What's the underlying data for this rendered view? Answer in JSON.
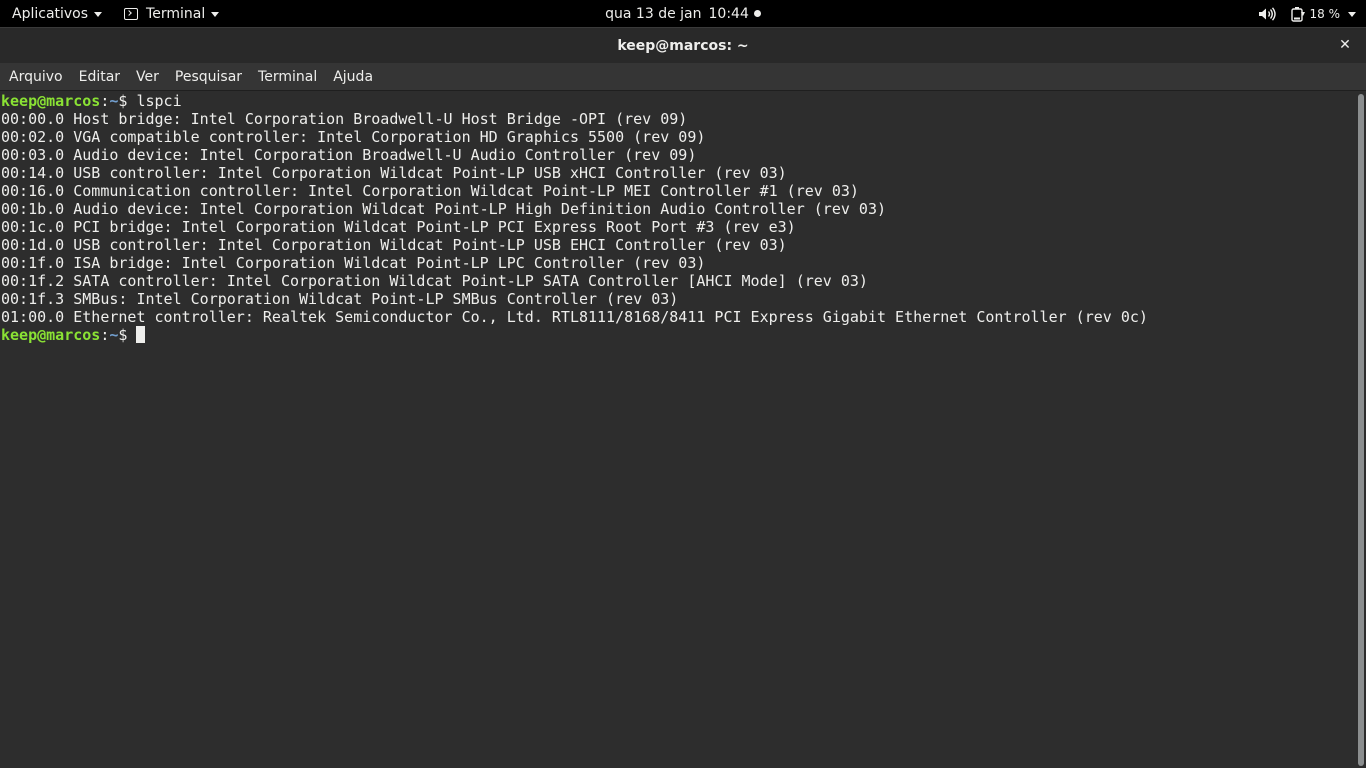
{
  "topbar": {
    "activities_label": "Aplicativos",
    "app_menu_label": "Terminal",
    "date": "qua 13 de jan",
    "time": "10:44",
    "battery_percent": "18 %"
  },
  "window": {
    "title": "keep@marcos: ~",
    "close_glyph": "✕"
  },
  "menubar": {
    "items": [
      "Arquivo",
      "Editar",
      "Ver",
      "Pesquisar",
      "Terminal",
      "Ajuda"
    ]
  },
  "terminal": {
    "prompt_user": "keep@marcos",
    "prompt_sep": ":",
    "prompt_path": "~",
    "prompt_symbol": "$ ",
    "command": "lspci",
    "output": [
      "00:00.0 Host bridge: Intel Corporation Broadwell-U Host Bridge -OPI (rev 09)",
      "00:02.0 VGA compatible controller: Intel Corporation HD Graphics 5500 (rev 09)",
      "00:03.0 Audio device: Intel Corporation Broadwell-U Audio Controller (rev 09)",
      "00:14.0 USB controller: Intel Corporation Wildcat Point-LP USB xHCI Controller (rev 03)",
      "00:16.0 Communication controller: Intel Corporation Wildcat Point-LP MEI Controller #1 (rev 03)",
      "00:1b.0 Audio device: Intel Corporation Wildcat Point-LP High Definition Audio Controller (rev 03)",
      "00:1c.0 PCI bridge: Intel Corporation Wildcat Point-LP PCI Express Root Port #3 (rev e3)",
      "00:1d.0 USB controller: Intel Corporation Wildcat Point-LP USB EHCI Controller (rev 03)",
      "00:1f.0 ISA bridge: Intel Corporation Wildcat Point-LP LPC Controller (rev 03)",
      "00:1f.2 SATA controller: Intel Corporation Wildcat Point-LP SATA Controller [AHCI Mode] (rev 03)",
      "00:1f.3 SMBus: Intel Corporation Wildcat Point-LP SMBus Controller (rev 03)",
      "01:00.0 Ethernet controller: Realtek Semiconductor Co., Ltd. RTL8111/8168/8411 PCI Express Gigabit Ethernet Controller (rev 0c)"
    ]
  },
  "colors": {
    "prompt_user": "#8ae234",
    "prompt_path": "#729fcf",
    "terminal_bg": "#2d2d2d",
    "terminal_fg": "#eeeeec"
  },
  "icons": {
    "app_menu": "terminal-icon",
    "volume": "volume-icon",
    "battery": "battery-icon",
    "close": "close-icon"
  }
}
